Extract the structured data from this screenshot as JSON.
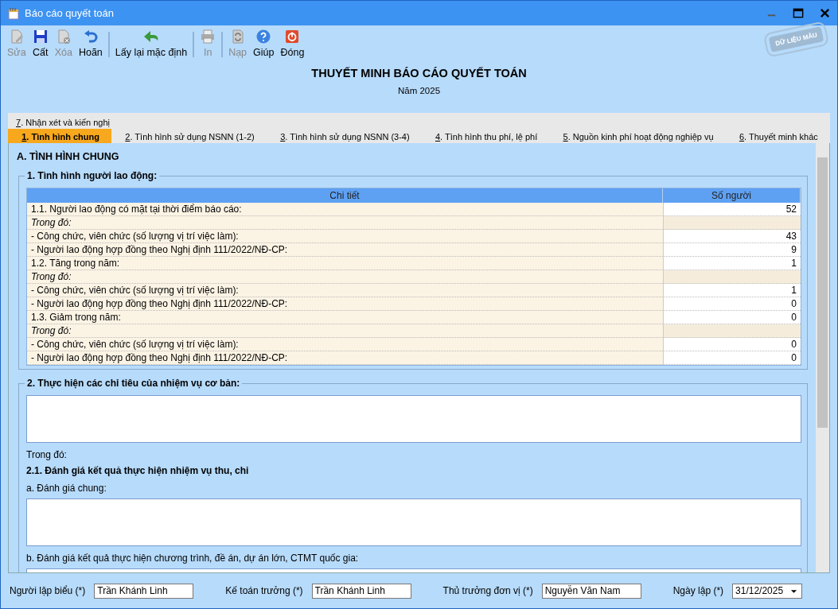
{
  "window": {
    "title": "Báo cáo quyết toán"
  },
  "toolbar": [
    {
      "label": "Sửa",
      "disabled": true,
      "separator_after": false
    },
    {
      "label": "Cất",
      "disabled": false,
      "separator_after": false
    },
    {
      "label": "Xóa",
      "disabled": true,
      "separator_after": false
    },
    {
      "label": "Hoãn",
      "disabled": false,
      "separator_after": true
    },
    {
      "label": "Lấy lại mặc định",
      "disabled": false,
      "separator_after": true
    },
    {
      "label": "In",
      "disabled": true,
      "separator_after": true
    },
    {
      "label": "Nạp",
      "disabled": true,
      "separator_after": false
    },
    {
      "label": "Giúp",
      "disabled": false,
      "separator_after": false
    },
    {
      "label": "Đóng",
      "disabled": false,
      "separator_after": false
    }
  ],
  "stamp": "DỮ LIỆU MẪU",
  "heading": {
    "title": "THUYẾT MINH BÁO CÁO QUYẾT TOÁN",
    "subtitle": "Năm 2025"
  },
  "tab_rows": [
    [
      {
        "key": "7",
        "label": ". Nhận xét và kiến nghị",
        "selected": false
      }
    ],
    [
      {
        "key": "1",
        "label": ". Tình hình chung",
        "selected": true
      },
      {
        "key": "2",
        "label": ". Tình hình sử dụng NSNN (1-2)",
        "selected": false
      },
      {
        "key": "3",
        "label": ". Tình hình sử dụng NSNN (3-4)",
        "selected": false
      },
      {
        "key": "4",
        "label": ". Tình hình thu phí, lệ phí",
        "selected": false
      },
      {
        "key": "5",
        "label": ". Nguồn kinh phí hoạt động nghiệp vụ",
        "selected": false
      },
      {
        "key": "6",
        "label": ". Thuyết minh khác",
        "selected": false
      }
    ]
  ],
  "section_title": "A. TÌNH HÌNH CHUNG",
  "labor": {
    "legend": "1. Tình hình người lao động:",
    "columns": [
      "Chi tiết",
      "Số người"
    ],
    "rows": [
      {
        "kind": "item",
        "label": "1.1. Người lao động có mặt tại thời điểm báo cáo:",
        "value": "52"
      },
      {
        "kind": "note",
        "label": "Trong đó:"
      },
      {
        "kind": "item",
        "label": "- Công chức, viên chức (số lượng vị trí việc làm):",
        "value": "43"
      },
      {
        "kind": "item",
        "label": "- Người lao động hợp đồng theo Nghị định 111/2022/NĐ-CP:",
        "value": "9"
      },
      {
        "kind": "item",
        "label": "1.2. Tăng trong năm:",
        "value": "1"
      },
      {
        "kind": "note",
        "label": "Trong đó:"
      },
      {
        "kind": "item",
        "label": "- Công chức, viên chức (số lượng vị trí việc làm):",
        "value": "1"
      },
      {
        "kind": "item",
        "label": "- Người lao động hợp đồng theo Nghị định 111/2022/NĐ-CP:",
        "value": "0"
      },
      {
        "kind": "item",
        "label": "1.3. Giảm trong năm:",
        "value": "0"
      },
      {
        "kind": "note",
        "label": "Trong đó:"
      },
      {
        "kind": "item",
        "label": "- Công chức, viên chức (số lượng vị trí việc làm):",
        "value": "0"
      },
      {
        "kind": "item",
        "label": "- Người lao động hợp đồng theo Nghị định 111/2022/NĐ-CP:",
        "value": "0"
      }
    ]
  },
  "tasks": {
    "legend": "2. Thực hiện các chỉ tiêu của nhiệm vụ cơ bản:",
    "note": "Trong đó:",
    "subheading": "2.1. Đánh giá kết quả thực hiện nhiệm vụ thu, chi",
    "general_label": "a. Đánh giá chung:",
    "programs_label": "b. Đánh giá kết quả thực hiện chương trình, đề án, dự án lớn, CTMT quốc gia:"
  },
  "footer": [
    {
      "label": "Người lập biểu (*)",
      "value": "Trần Khánh Linh",
      "kind": "text"
    },
    {
      "label": "Kế toán trưởng (*)",
      "value": "Trần Khánh Linh",
      "kind": "text"
    },
    {
      "label": "Thủ trưởng đơn vị (*)",
      "value": "Nguyễn Văn Nam",
      "kind": "text"
    },
    {
      "label": "Ngày lập (*)",
      "value": "31/12/2025",
      "kind": "date"
    }
  ]
}
